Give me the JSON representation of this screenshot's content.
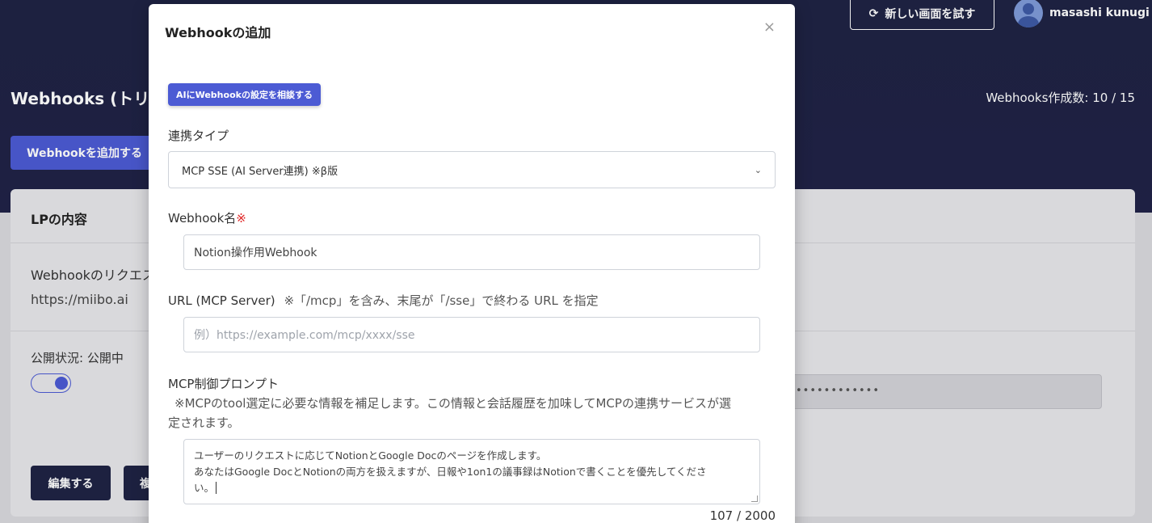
{
  "header": {
    "new_screen_label": "新しい画面を試す",
    "user_name": "masashi kunugi"
  },
  "page": {
    "title": "Webhooks (トリガ",
    "webhook_count": "Webhooks作成数: 10 / 15",
    "add_button": "Webhookを追加する"
  },
  "card": {
    "title": "LPの内容",
    "request_label": "Webhookのリクエス",
    "request_url": "https://miibo.ai",
    "public_status": "公開状況: 公開中",
    "secret_masked": "••••••••••••",
    "edit_button": "編集する",
    "copy_button": "複"
  },
  "modal": {
    "title": "Webhookの追加",
    "close": "×",
    "ai_button": "AIにWebhookの設定を相談する",
    "type_label": "連携タイプ",
    "type_value": "MCP SSE (AI Server連携) ※β版",
    "name_label": "Webhook名",
    "required_mark": "※",
    "name_value": "Notion操作用Webhook",
    "url_label": "URL (MCP Server)",
    "url_note": "※「/mcp」を含み、末尾が「/sse」で終わる URL を指定",
    "url_placeholder": "例）https://example.com/mcp/xxxx/sse",
    "prompt_label": "MCP制御プロンプト",
    "prompt_note_line1": "※MCPのtool選定に必要な情報を補足します。この情報と会話履歴を加味してMCPの連携サービスが選",
    "prompt_note_line2": "定されます。",
    "prompt_line1": "ユーザーのリクエストに応じてNotionとGoogle Docのページを作成します。",
    "prompt_line2": "あなたはGoogle DocとNotionの両方を扱えますが、日報や1on1の議事録はNotionで書くことを優先してくださ",
    "prompt_line3": "い。",
    "char_count": "107 / 2000"
  },
  "icons": {
    "refresh": "refresh-icon",
    "avatar": "user-avatar-icon",
    "close": "close-icon",
    "chevron": "chevron-down-icon"
  },
  "colors": {
    "header_bg": "#1f2444",
    "accent": "#4c5bd4",
    "required": "#e02424"
  }
}
